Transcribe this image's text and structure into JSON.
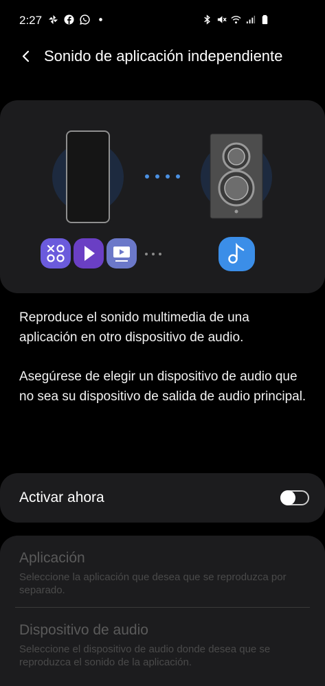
{
  "status": {
    "time": "2:27",
    "left_icons": [
      "pinwheel-icon",
      "facebook-icon",
      "whatsapp-icon",
      "dot-icon"
    ],
    "right_icons": [
      "bluetooth-icon",
      "mute-icon",
      "wifi-icon",
      "signal-icon",
      "battery-icon"
    ]
  },
  "header": {
    "title": "Sonido de aplicación independiente"
  },
  "hero": {
    "app_icons": [
      "games-app-icon",
      "play-app-icon",
      "video-app-icon",
      "more-dots-icon"
    ],
    "target_icon": "music-note-icon",
    "colors": {
      "accent": "#4a90e2",
      "card": "#1c1c1e",
      "halo": "#1d2a3f"
    }
  },
  "description": {
    "line1": "Reproduce el sonido multimedia de una aplicación en otro dispositivo de audio.",
    "line2": "Asegúrese de elegir un dispositivo de audio que no sea su dispositivo de salida de audio principal."
  },
  "toggle": {
    "label": "Activar ahora",
    "on": false
  },
  "settings": {
    "app": {
      "title": "Aplicación",
      "desc": "Seleccione la aplicación que desea que se reproduzca por separado."
    },
    "device": {
      "title": "Dispositivo de audio",
      "desc": "Seleccione el dispositivo de audio donde desea que se reproduzca el sonido de la aplicación."
    }
  }
}
